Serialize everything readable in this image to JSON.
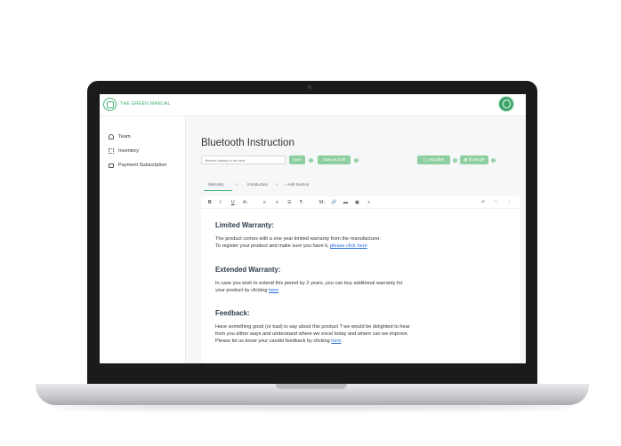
{
  "brand": {
    "name": "THE GREEN MANUAL"
  },
  "sidebar": {
    "items": [
      {
        "label": "Team",
        "icon": "person-icon"
      },
      {
        "label": "Inventory",
        "icon": "inventory-icon"
      },
      {
        "label": "Payment Subscription",
        "icon": "card-icon"
      }
    ]
  },
  "page": {
    "title": "Bluetooth Instruction"
  },
  "toolbar": {
    "version_placeholder": "Version history to be here",
    "save_label": "Save",
    "save_draft_label": "Save as Draft",
    "unpublish_label": "Unpublish",
    "show_qr_label": "Show QR",
    "help_glyph": "?"
  },
  "tabs": [
    {
      "label": "Warranty",
      "active": true
    },
    {
      "label": "Introduction",
      "active": false
    }
  ],
  "add_section_label": "Add Section",
  "editor_toolbar": {
    "bold": "B",
    "italic": "I",
    "underline": "U",
    "font_size": "A↕",
    "align_left": "≡",
    "align_center": "≡",
    "list": "☰",
    "paragraph": "¶",
    "image_text": "M↓",
    "link": "🔗",
    "folder": "▬",
    "image": "▣",
    "more": "+",
    "undo": "↶",
    "redo": "↷",
    "menu": "⋮"
  },
  "content": {
    "limited": {
      "heading": "Limited Warranty:",
      "line1": "The product comes with a one year limited warranty from the manufacturer.",
      "line2_prefix": "To register your product and make sure you have it, ",
      "line2_link": "please click here"
    },
    "extended": {
      "heading": "Extended Warranty:",
      "line1": "In case you wish to extend this period by 2 years, you can buy additional warranty for",
      "line2_prefix": "your product by clicking ",
      "line2_link": "here"
    },
    "feedback": {
      "heading": "Feedback:",
      "line1": "Have something good (or bad) to say about this product ? we would be delighted to hear",
      "line2": "from you either ways and understand where we excel today and where can we improve.",
      "line3_prefix": "Please let us know your candid feedback by clicking ",
      "line3_link": "here"
    }
  },
  "colors": {
    "accent": "#48b27a",
    "button": "#8fcf9f",
    "link": "#2a6fdb",
    "frame": "#1b1b1d"
  }
}
